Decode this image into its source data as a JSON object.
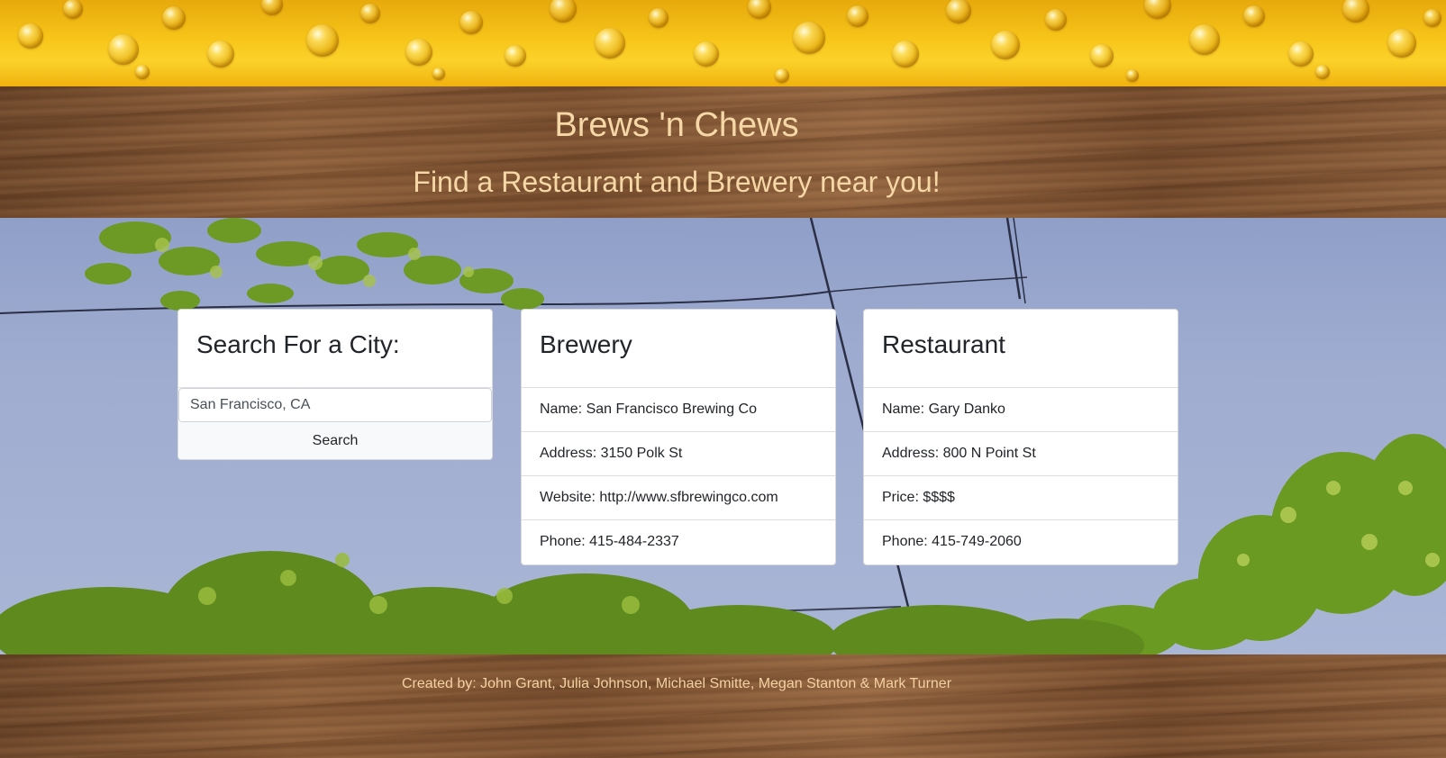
{
  "header": {
    "title": "Brews 'n Chews",
    "subtitle": "Find a Restaurant and Brewery near you!"
  },
  "search": {
    "heading": "Search For a City:",
    "input_value": "San Francisco, CA",
    "button_label": "Search"
  },
  "brewery": {
    "heading": "Brewery",
    "name": "Name: San Francisco Brewing Co",
    "address": "Address: 3150 Polk St",
    "website": "Website: http://www.sfbrewingco.com",
    "phone": "Phone: 415-484-2337"
  },
  "restaurant": {
    "heading": "Restaurant",
    "name": "Name: Gary Danko",
    "address": "Address: 800 N Point St",
    "price": "Price: $$$$",
    "phone": "Phone: 415-749-2060"
  },
  "footer": {
    "credits": "Created by: John Grant, Julia Johnson, Michael Smitte, Megan Stanton & Mark Turner"
  },
  "colors": {
    "title_text": "#f6d7a6",
    "footer_text": "#f3d2a2",
    "beer": "#f7c51a",
    "wood": "#7a4f2f",
    "sky": "#9eabd0",
    "hops": "#5f8a1e"
  }
}
